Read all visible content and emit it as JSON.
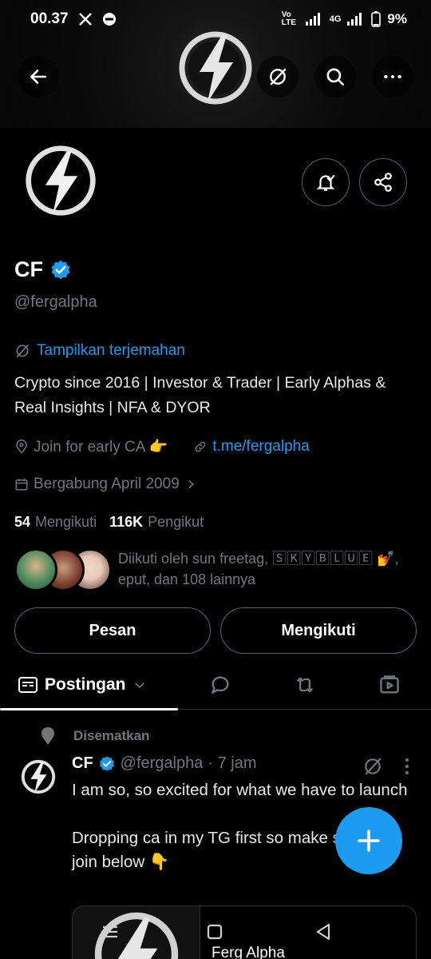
{
  "status_bar": {
    "time": "00.37",
    "carrier_tag": "Vo LTE",
    "network": "4G",
    "battery": "9%"
  },
  "profile": {
    "name": "CF",
    "handle": "@fergalpha",
    "translate_label": "Tampilkan terjemahan",
    "bio": "Crypto since 2016 | Investor & Trader | Early Alphas & Real Insights | NFA & DYOR",
    "location": "Join for early CA 👉",
    "link": "t.me/fergalpha",
    "joined": "Bergabung April 2009",
    "following_count": "54",
    "following_label": "Mengikuti",
    "followers_count": "116K",
    "followers_label": "Pengikut",
    "followed_by": "Diikuti oleh sun freetag, 🅂🄺🅈🄱🄻🅄🄴 💅, eput, dan 108 lainnya"
  },
  "actions": {
    "message": "Pesan",
    "following": "Mengikuti"
  },
  "tabs": {
    "posts": "Postingan"
  },
  "post": {
    "pinned_label": "Disematkan",
    "author": "CF",
    "handle": "@fergalpha",
    "time": "· 7 jam",
    "text": "I am so, so excited for what we have to launch\n\nDropping ca in my TG first so make sure you join below 👇",
    "card_title": "Ferg Alpha"
  },
  "icons": {
    "back": "arrow-left-icon",
    "grok": "grok-icon",
    "search": "search-icon",
    "more": "more-icon",
    "notify": "bell-check-icon",
    "share": "share-icon",
    "verified": "verified-badge-icon"
  },
  "colors": {
    "accent": "#1d9bf0",
    "muted": "#71767b",
    "border": "#2f3336",
    "bg": "#000000"
  }
}
